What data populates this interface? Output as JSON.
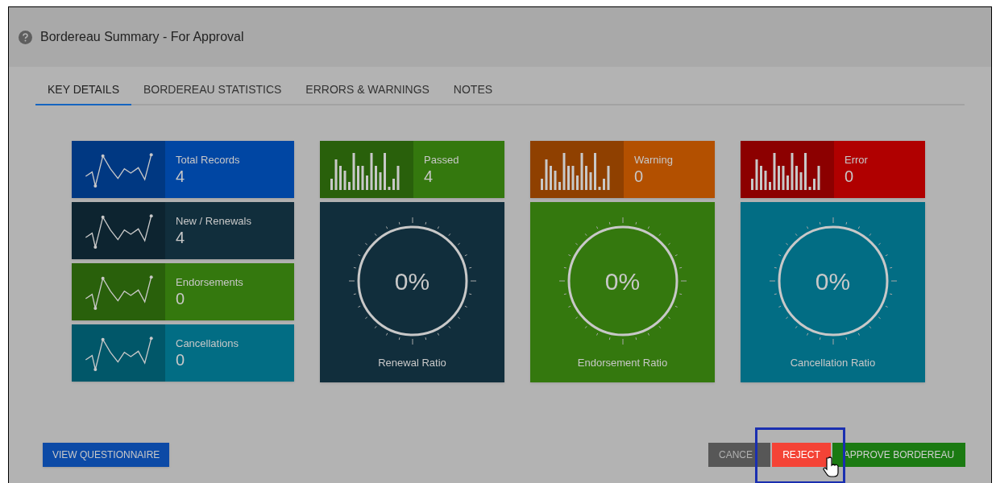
{
  "window": {
    "title": "Bordereau Summary - For Approval"
  },
  "tabs": [
    {
      "label": "KEY DETAILS",
      "selected": true
    },
    {
      "label": "BORDEREAU STATISTICS",
      "selected": false
    },
    {
      "label": "ERRORS & WARNINGS",
      "selected": false
    },
    {
      "label": "NOTES",
      "selected": false
    }
  ],
  "summary_tiles": [
    {
      "kind": "line",
      "label": "Total Records",
      "value": "4",
      "color": "#0046a3"
    },
    {
      "kind": "line",
      "label": "New / Renewals",
      "value": "4",
      "color": "#112e3c"
    },
    {
      "kind": "line",
      "label": "Endorsements",
      "value": "0",
      "color": "#34780e"
    },
    {
      "kind": "line",
      "label": "Cancellations",
      "value": "0",
      "color": "#026d84"
    }
  ],
  "columns": [
    {
      "tile": {
        "kind": "bars",
        "label": "Passed",
        "value": "4",
        "color": "#34780e"
      },
      "gauge": {
        "value": "0%",
        "label": "Renewal Ratio",
        "color": "#112e3c"
      }
    },
    {
      "tile": {
        "kind": "bars",
        "label": "Warning",
        "value": "0",
        "color": "#b35000"
      },
      "gauge": {
        "value": "0%",
        "label": "Endorsement Ratio",
        "color": "#34780e"
      }
    },
    {
      "tile": {
        "kind": "bars",
        "label": "Error",
        "value": "0",
        "color": "#b00000"
      },
      "gauge": {
        "value": "0%",
        "label": "Cancellation Ratio",
        "color": "#026d84"
      }
    }
  ],
  "buttons": {
    "left": "VIEW QUESTIONNAIRE",
    "cancel": "CANCE",
    "reject": "REJECT",
    "approve": "APPROVE BORDEREAU"
  }
}
